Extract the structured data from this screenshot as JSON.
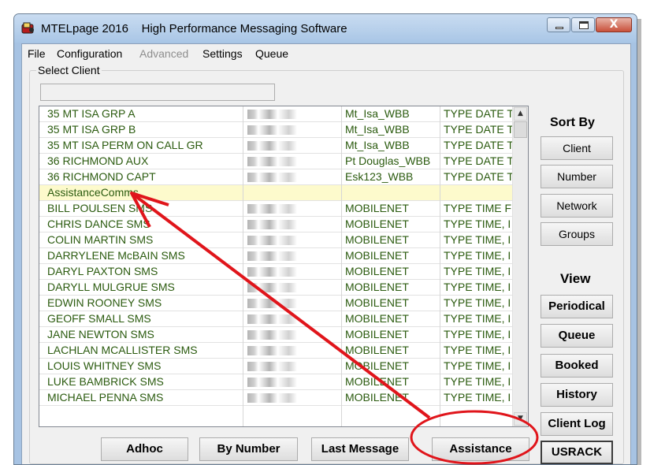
{
  "window": {
    "title": "MTELpage 2016    High Performance Messaging Software",
    "close_glyph": "X"
  },
  "menu": {
    "items": [
      {
        "label": "File",
        "enabled": true
      },
      {
        "label": "Configuration",
        "enabled": true
      },
      {
        "label": "Advanced",
        "enabled": false
      },
      {
        "label": "Settings",
        "enabled": true
      },
      {
        "label": "Queue",
        "enabled": true
      }
    ]
  },
  "select_client": {
    "label": "Select Client",
    "search_value": ""
  },
  "client_list": {
    "rows": [
      {
        "name": "35 MT ISA GRP A",
        "number": "",
        "network": "Mt_Isa_WBB",
        "type": "TYPE DATE T",
        "redacted": true
      },
      {
        "name": "35 MT ISA GRP B",
        "number": "",
        "network": "Mt_Isa_WBB",
        "type": "TYPE DATE T",
        "redacted": true
      },
      {
        "name": "35 MT ISA PERM ON CALL GR",
        "number": "",
        "network": "Mt_Isa_WBB",
        "type": "TYPE DATE T",
        "redacted": true
      },
      {
        "name": "36 RICHMOND AUX",
        "number": "",
        "network": "Pt Douglas_WBB",
        "type": "TYPE DATE T",
        "redacted": true
      },
      {
        "name": "36 RICHMOND CAPT",
        "number": "",
        "network": "Esk123_WBB",
        "type": "TYPE DATE T",
        "redacted": true
      },
      {
        "name": "AssistanceComms",
        "number": "",
        "network": "",
        "type": "",
        "redacted": false,
        "selected": true
      },
      {
        "name": "BILL POULSEN SMS",
        "number": "",
        "network": "MOBILENET",
        "type": "TYPE TIME F",
        "redacted": true
      },
      {
        "name": "CHRIS DANCE SMS",
        "number": "",
        "network": "MOBILENET",
        "type": "TYPE TIME, I",
        "redacted": true
      },
      {
        "name": "COLIN MARTIN SMS",
        "number": "",
        "network": "MOBILENET",
        "type": "TYPE TIME, I",
        "redacted": true
      },
      {
        "name": "DARRYLENE McBAIN SMS",
        "number": "",
        "network": "MOBILENET",
        "type": "TYPE TIME, I",
        "redacted": true
      },
      {
        "name": "DARYL PAXTON SMS",
        "number": "",
        "network": "MOBILENET",
        "type": "TYPE TIME, I",
        "redacted": true
      },
      {
        "name": "DARYLL MULGRUE SMS",
        "number": "",
        "network": "MOBILENET",
        "type": "TYPE TIME, I",
        "redacted": true
      },
      {
        "name": "EDWIN ROONEY SMS",
        "number": "",
        "network": "MOBILENET",
        "type": "TYPE TIME, I",
        "redacted": true
      },
      {
        "name": "GEOFF SMALL SMS",
        "number": "",
        "network": "MOBILENET",
        "type": "TYPE TIME, I",
        "redacted": true
      },
      {
        "name": "JANE NEWTON SMS",
        "number": "",
        "network": "MOBILENET",
        "type": "TYPE TIME, I",
        "redacted": true
      },
      {
        "name": "LACHLAN MCALLISTER SMS",
        "number": "",
        "network": "MOBILENET",
        "type": "TYPE TIME, I",
        "redacted": true
      },
      {
        "name": "LOUIS WHITNEY SMS",
        "number": "",
        "network": "MOBILENET",
        "type": "TYPE TIME, I",
        "redacted": true
      },
      {
        "name": "LUKE BAMBRICK SMS",
        "number": "",
        "network": "MOBILENET",
        "type": "TYPE TIME, I",
        "redacted": true
      },
      {
        "name": "MICHAEL PENNA SMS",
        "number": "",
        "network": "MOBILENET",
        "type": "TYPE TIME, I",
        "redacted": true
      }
    ],
    "scroll_up_glyph": "▲",
    "scroll_down_glyph": "▼"
  },
  "sort_by": {
    "heading": "Sort By",
    "buttons": [
      "Client",
      "Number",
      "Network",
      "Groups"
    ]
  },
  "view": {
    "heading": "View",
    "buttons": [
      "Periodical",
      "Queue",
      "Booked",
      "History",
      "Client Log",
      "USRACK"
    ]
  },
  "bottom_buttons": {
    "adhoc": "Adhoc",
    "by_number": "By Number",
    "last_message": "Last Message",
    "assistance": "Assistance"
  },
  "annotation": {
    "color": "#e0151b"
  },
  "icons": {
    "app": "mtel-app-icon",
    "minimize": "minimize-icon",
    "maximize": "maximize-icon",
    "close": "close-icon"
  }
}
